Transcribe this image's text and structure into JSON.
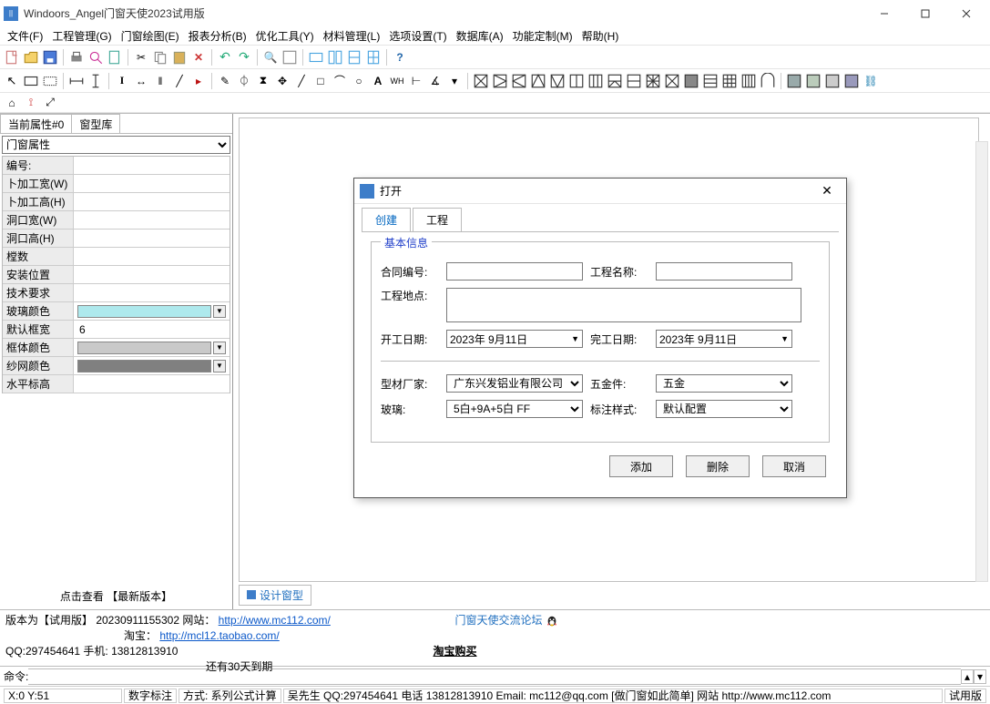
{
  "window": {
    "title": "Windoors_Angel门窗天使2023试用版"
  },
  "menu": {
    "file": "文件(F)",
    "project": "工程管理(G)",
    "draw": "门窗绘图(E)",
    "report": "报表分析(B)",
    "optimize": "优化工具(Y)",
    "material": "材料管理(L)",
    "options": "选项设置(T)",
    "database": "数据库(A)",
    "custom": "功能定制(M)",
    "help": "帮助(H)"
  },
  "side": {
    "tab_attr": "当前属性#0",
    "tab_lib": "窗型库",
    "select_value": "门窗属性",
    "rows": [
      {
        "label": "编号:",
        "type": "text",
        "value": ""
      },
      {
        "label": "卜加工宽(W)",
        "type": "text",
        "value": ""
      },
      {
        "label": "卜加工高(H)",
        "type": "text",
        "value": ""
      },
      {
        "label": "洞口宽(W)",
        "type": "text",
        "value": ""
      },
      {
        "label": "洞口高(H)",
        "type": "text",
        "value": ""
      },
      {
        "label": "樘数",
        "type": "text",
        "value": ""
      },
      {
        "label": "安装位置",
        "type": "text",
        "value": ""
      },
      {
        "label": "技术要求",
        "type": "text",
        "value": ""
      },
      {
        "label": "玻璃颜色",
        "type": "color",
        "color": "#aee9ed"
      },
      {
        "label": "默认框宽",
        "type": "text",
        "value": "6"
      },
      {
        "label": "框体颜色",
        "type": "color",
        "color": "#c9c9c9"
      },
      {
        "label": "纱网颜色",
        "type": "color",
        "color": "#808080"
      },
      {
        "label": "水平标高",
        "type": "text",
        "value": ""
      }
    ],
    "footer": "点击查看 【最新版本】"
  },
  "canvas_tab": "设计窗型",
  "dialog": {
    "title": "打开",
    "tab_create": "创建",
    "tab_project": "工程",
    "fieldset": "基本信息",
    "contract_no": "合同编号:",
    "project_name": "工程名称:",
    "project_addr": "工程地点:",
    "start_date_label": "开工日期:",
    "start_date": "2023年 9月11日",
    "end_date_label": "完工日期:",
    "end_date": "2023年 9月11日",
    "profile_label": "型材厂家:",
    "profile_value": "广东兴发铝业有限公司",
    "hardware_label": "五金件:",
    "hardware_value": "五金",
    "glass_label": "玻璃:",
    "glass_value": "5白+9A+5白 FF",
    "style_label": "标注样式:",
    "style_value": "默认配置",
    "btn_add": "添加",
    "btn_del": "删除",
    "btn_cancel": "取消"
  },
  "info": {
    "line1a": "版本为【试用版】 20230911155302   网站：",
    "url1": "http://www.mc112.com/",
    "line2a": "淘宝：",
    "url2": "http://mcl12.taobao.com/",
    "line3": "QQ:297454641 手机: 13812813910",
    "forum": "门窗天使交流论坛",
    "days": "还有30天到期",
    "taobao_buy": "淘宝购买"
  },
  "cmd_label": "命令:",
  "status": {
    "coord": "X:0  Y:51",
    "digital": "数字标注",
    "mode": "方式: 系列公式计算",
    "contact": "吴先生  QQ:297454641  电话  13812813910  Email: mc112@qq.com [做门窗如此简单]  网站   http://www.mc112.com",
    "trial": "试用版"
  }
}
